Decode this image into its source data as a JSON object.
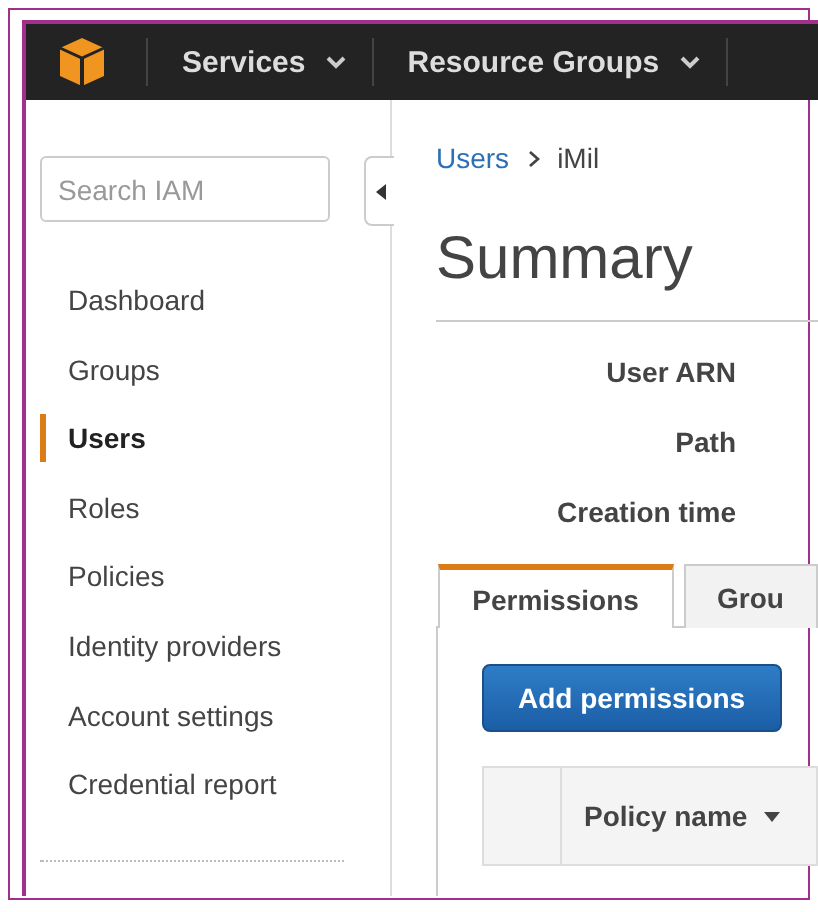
{
  "navbar": {
    "menus": [
      {
        "label": "Services"
      },
      {
        "label": "Resource Groups"
      }
    ]
  },
  "sidebar": {
    "search": {
      "placeholder": "Search IAM"
    },
    "items": [
      {
        "label": "Dashboard",
        "selected": false
      },
      {
        "label": "Groups",
        "selected": false
      },
      {
        "label": "Users",
        "selected": true
      },
      {
        "label": "Roles",
        "selected": false
      },
      {
        "label": "Policies",
        "selected": false
      },
      {
        "label": "Identity providers",
        "selected": false
      },
      {
        "label": "Account settings",
        "selected": false
      },
      {
        "label": "Credential report",
        "selected": false
      }
    ]
  },
  "breadcrumb": [
    {
      "label": "Users",
      "kind": "link"
    },
    {
      "label": "iMil",
      "kind": "current"
    }
  ],
  "title": "Summary",
  "summary_fields": [
    {
      "label": "User ARN"
    },
    {
      "label": "Path"
    },
    {
      "label": "Creation time"
    }
  ],
  "tabs": [
    {
      "label": "Permissions",
      "selected": true
    },
    {
      "label": "Grou",
      "selected": false
    }
  ],
  "add_button": "Add permissions",
  "table": {
    "columns": [
      {
        "kind": "select"
      },
      {
        "label": "Policy name",
        "kind": "sortable"
      }
    ]
  }
}
